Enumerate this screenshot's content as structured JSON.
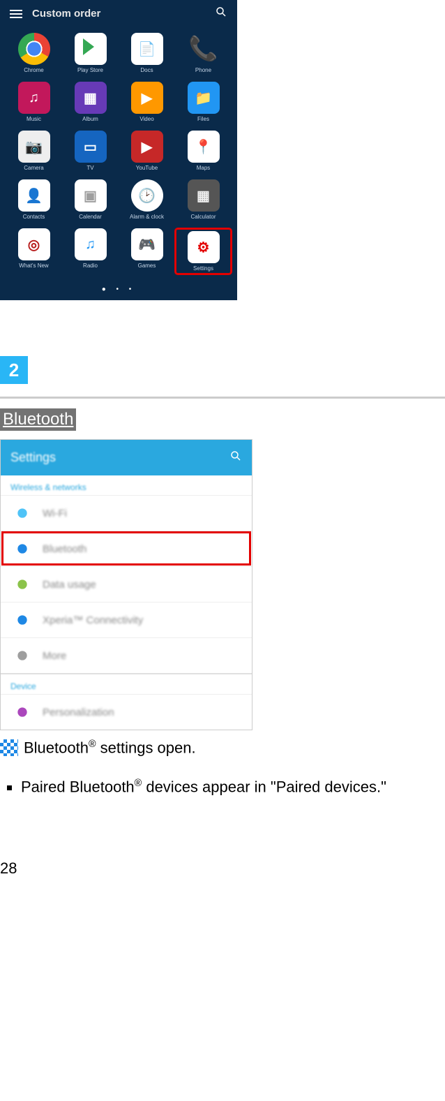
{
  "drawer": {
    "title": "Custom order",
    "apps": [
      {
        "label": "Chrome",
        "iconClass": "ic-chrome"
      },
      {
        "label": "Play Store",
        "iconClass": "ic-play"
      },
      {
        "label": "Docs",
        "iconClass": "ic-doc"
      },
      {
        "label": "Phone",
        "iconClass": "ic-phone"
      },
      {
        "label": "Music",
        "iconClass": "ic-music"
      },
      {
        "label": "Album",
        "iconClass": "ic-album"
      },
      {
        "label": "Video",
        "iconClass": "ic-video"
      },
      {
        "label": "Files",
        "iconClass": "ic-files"
      },
      {
        "label": "Camera",
        "iconClass": "ic-camera"
      },
      {
        "label": "TV",
        "iconClass": "ic-tv"
      },
      {
        "label": "YouTube",
        "iconClass": "ic-yt"
      },
      {
        "label": "Maps",
        "iconClass": "ic-maps"
      },
      {
        "label": "Contacts",
        "iconClass": "ic-cont"
      },
      {
        "label": "Calendar",
        "iconClass": "ic-cal"
      },
      {
        "label": "Alarm & clock",
        "iconClass": "ic-clock"
      },
      {
        "label": "Calculator",
        "iconClass": "ic-calc"
      },
      {
        "label": "What's New",
        "iconClass": "ic-white"
      },
      {
        "label": "Radio",
        "iconClass": "ic-wave"
      },
      {
        "label": "Games",
        "iconClass": "ic-games"
      },
      {
        "label": "Settings",
        "iconClass": "ic-settings",
        "highlight": true
      }
    ]
  },
  "step": {
    "number": "2"
  },
  "heading": "Bluetooth",
  "settings": {
    "title": "Settings",
    "category1": "Wireless & networks",
    "rows1": [
      {
        "label": "Wi-Fi",
        "iconColor": "#4fc3f7"
      },
      {
        "label": "Bluetooth",
        "iconColor": "#1e88e5",
        "highlight": true
      },
      {
        "label": "Data usage",
        "iconColor": "#8bc34a"
      },
      {
        "label": "Xperia™ Connectivity",
        "iconColor": "#1e88e5"
      },
      {
        "label": "More",
        "iconColor": "#9e9e9e"
      }
    ],
    "category2": "Device",
    "rows2": [
      {
        "label": "Personalization",
        "iconColor": "#ab47bc"
      }
    ]
  },
  "result": {
    "prefix": " Bluetooth",
    "suffix": " settings open."
  },
  "bullet": {
    "prefix": "Paired Bluetooth",
    "suffix": " devices appear in \"Paired devices.\""
  },
  "page": "28"
}
